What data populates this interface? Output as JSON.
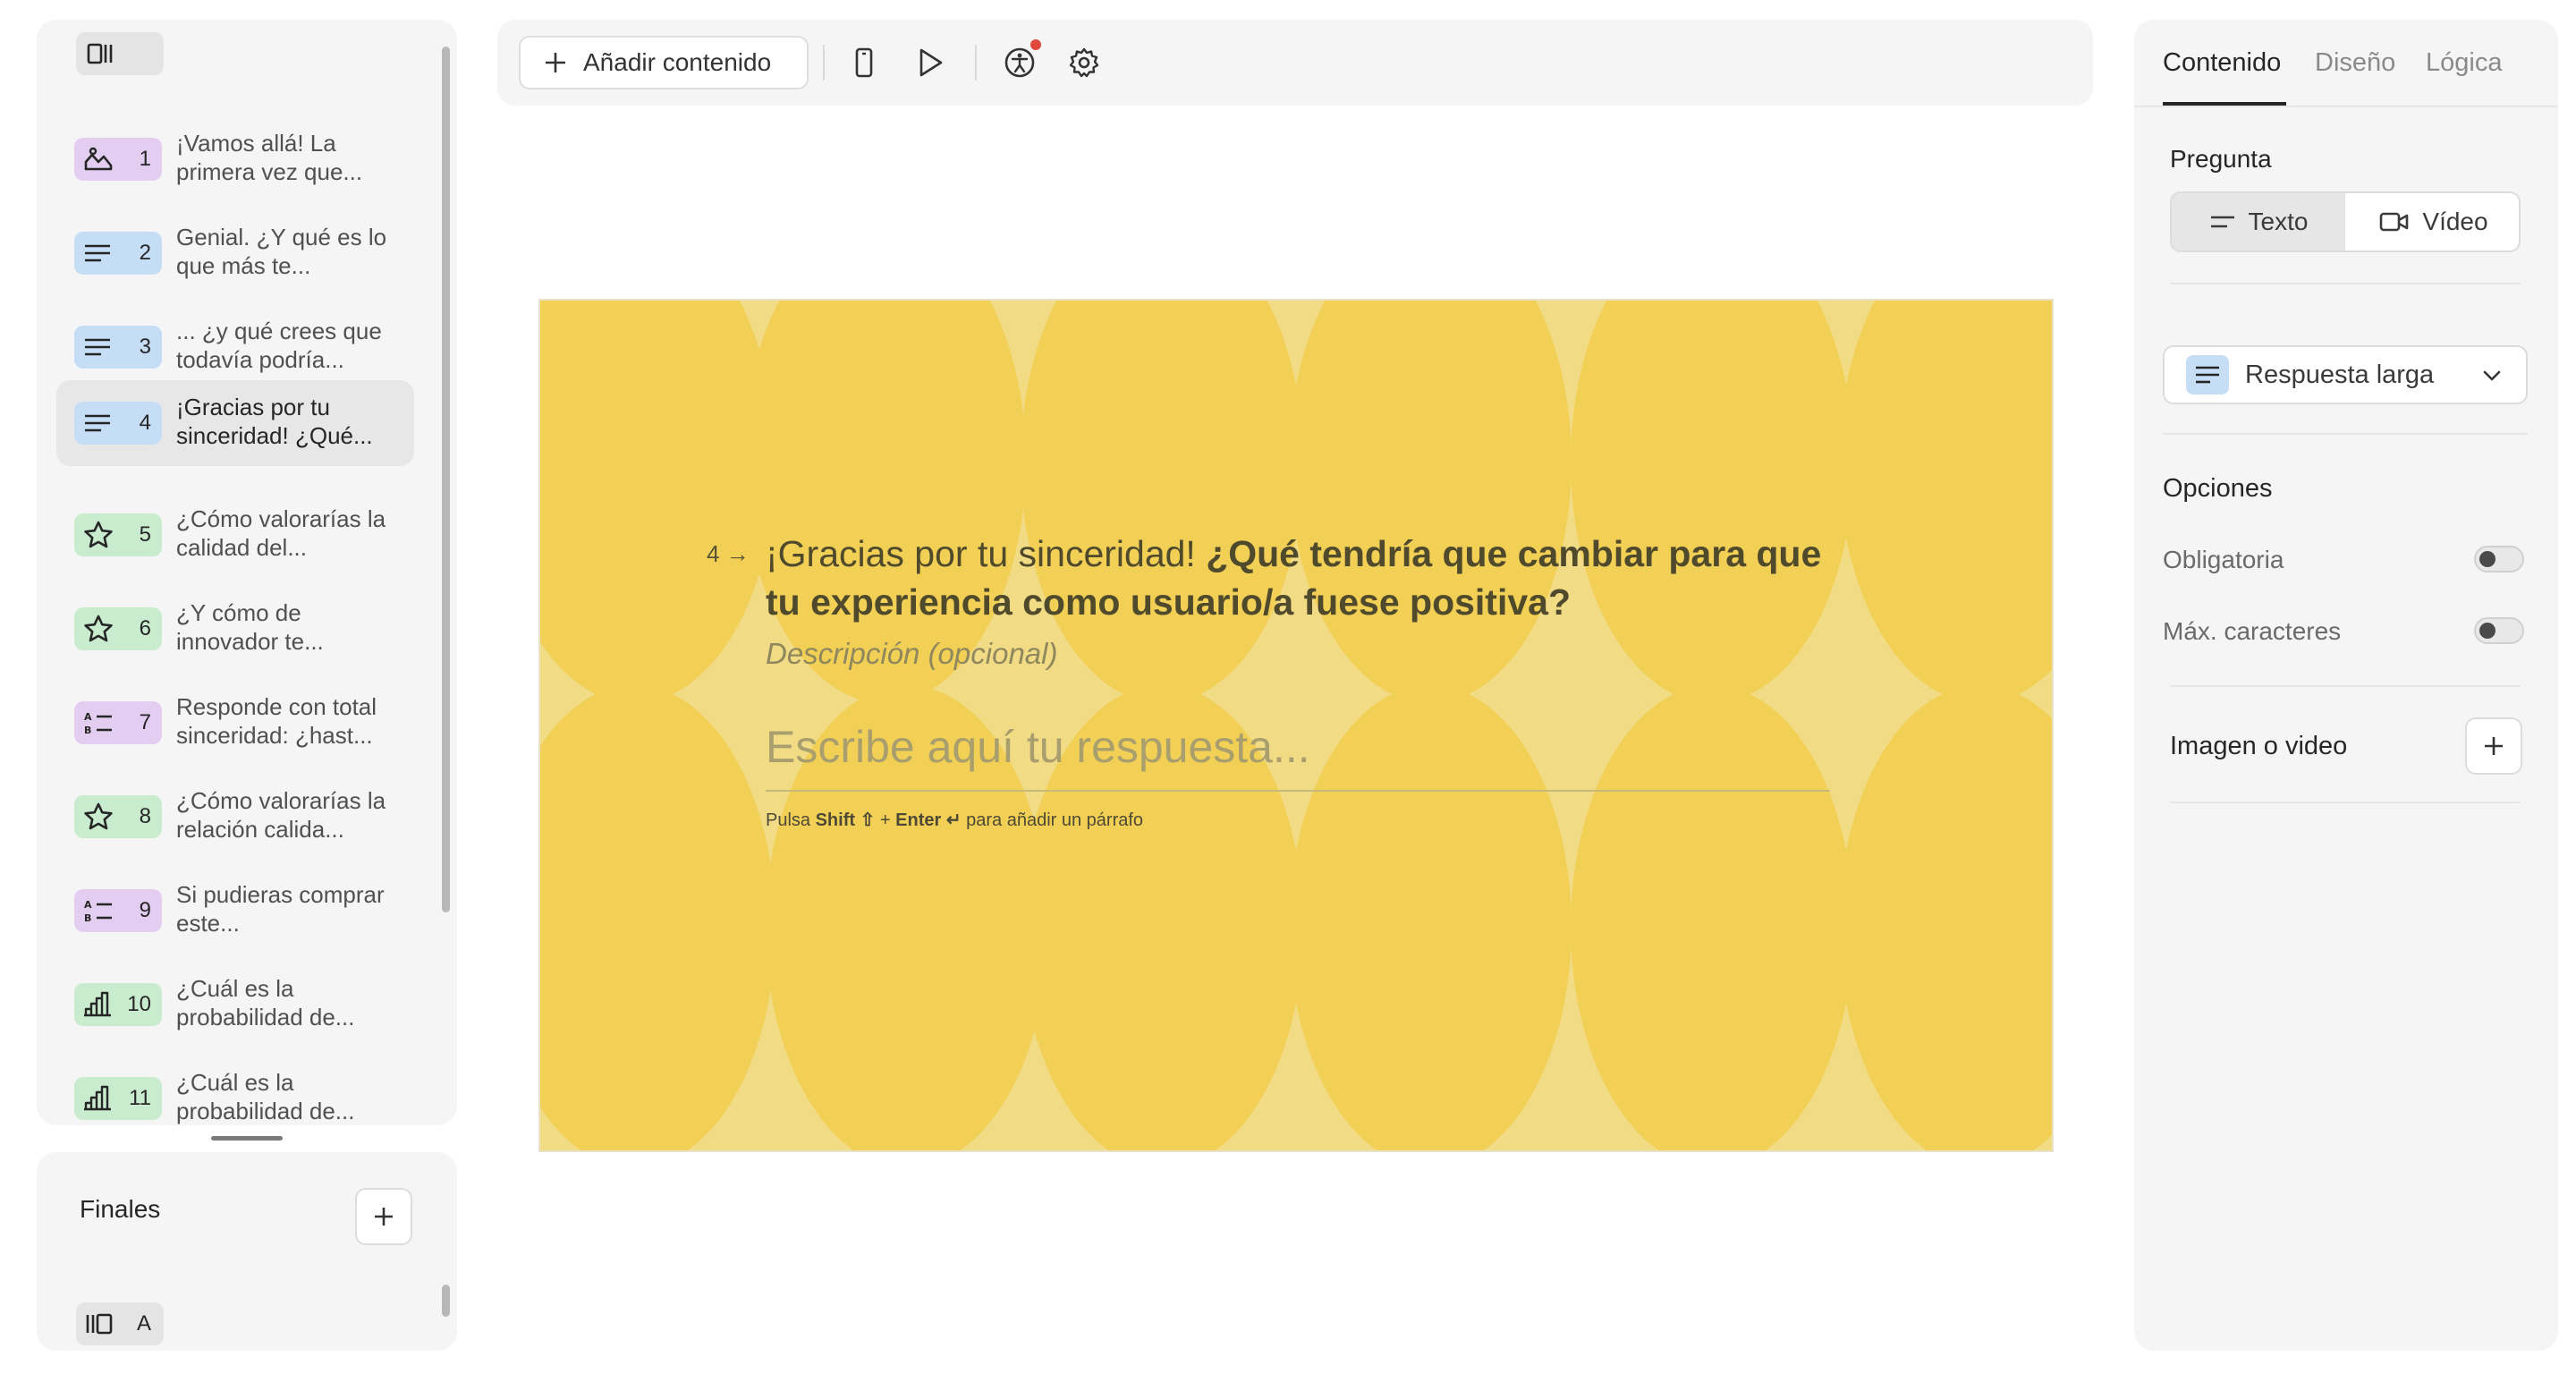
{
  "sidebar": {
    "items": [
      {
        "num": "1",
        "text": "¡Vamos allá! La primera vez que...",
        "icon": "welcome-screen-icon",
        "color": "#e3cdf0"
      },
      {
        "num": "2",
        "text": "Genial. ¿Y qué es lo que más te...",
        "icon": "long-text-icon",
        "color": "#c6ddf6"
      },
      {
        "num": "3",
        "text": "... ¿y qué crees que todavía podría...",
        "icon": "long-text-icon",
        "color": "#c6ddf6"
      },
      {
        "num": "4",
        "text": "¡Gracias por tu sinceridad! ¿Qué...",
        "icon": "long-text-icon",
        "color": "#c6ddf6"
      },
      {
        "num": "5",
        "text": "¿Cómo valorarías la calidad del...",
        "icon": "star-icon",
        "color": "#c9eccf"
      },
      {
        "num": "6",
        "text": "¿Y cómo de innovador te...",
        "icon": "star-icon",
        "color": "#c9eccf"
      },
      {
        "num": "7",
        "text": "Responde con total sinceridad: ¿hast...",
        "icon": "ranking-icon",
        "color": "#e3cdf0"
      },
      {
        "num": "8",
        "text": "¿Cómo valorarías la relación calida...",
        "icon": "star-icon",
        "color": "#c9eccf"
      },
      {
        "num": "9",
        "text": "Si pudieras comprar este...",
        "icon": "ranking-icon",
        "color": "#e3cdf0"
      },
      {
        "num": "10",
        "text": "¿Cuál es la probabilidad de...",
        "icon": "scale-icon",
        "color": "#c9eccf"
      },
      {
        "num": "11",
        "text": "¿Cuál es la probabilidad de...",
        "icon": "scale-icon",
        "color": "#c9eccf"
      }
    ],
    "finals": {
      "title": "Finales",
      "chip": "A"
    }
  },
  "toolbar": {
    "add_content": "Añadir contenido"
  },
  "canvas": {
    "number": "4",
    "title_plain": "¡Gracias por tu sinceridad! ",
    "title_bold": "¿Qué tendría que cambiar para que tu experiencia como usuario/a fuese positiva?",
    "description": "Descripción (opcional)",
    "answer_placeholder": "Escribe aquí tu respuesta...",
    "hint": {
      "pre": "Pulsa ",
      "shift": "Shift ⇧",
      "plus": " + ",
      "enter": "Enter ↵",
      "post": " para añadir un párrafo"
    },
    "bg_color": "#f2d366"
  },
  "right_panel": {
    "tabs": [
      "Contenido",
      "Diseño",
      "Lógica"
    ],
    "pregunta": "Pregunta",
    "type_texto": "Texto",
    "type_video": "Vídeo",
    "answer_type": "Respuesta larga",
    "opciones": "Opciones",
    "obligatoria": "Obligatoria",
    "max_caracteres": "Máx. caracteres",
    "imagen_video": "Imagen o video"
  }
}
